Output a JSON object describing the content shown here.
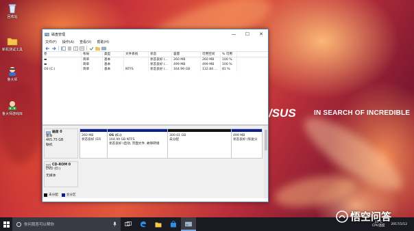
{
  "desktop": {
    "icons": [
      {
        "label": "回收站",
        "icon": "recycle-bin-icon"
      },
      {
        "label": "新机测试工具",
        "icon": "folder-icon"
      },
      {
        "label": "鲁大师",
        "icon": "ludashi-icon"
      },
      {
        "label": "鲁大师游戏库",
        "icon": "ludashi-game-icon"
      }
    ],
    "wallpaper": {
      "brand": "/SUS",
      "tagline": "IN SEARCH OF INCREDIBLE"
    }
  },
  "window": {
    "title": "磁盘管理",
    "controls": {
      "minimize": "—",
      "maximize": "☐",
      "close": "✕"
    },
    "menu": [
      "文件(F)",
      "操作(A)",
      "查看(V)",
      "帮助(H)"
    ],
    "volume_table": {
      "headers": [
        "卷",
        "布局",
        "类型",
        "文件系统",
        "状态",
        "容量",
        "可用空间",
        "% 可用"
      ],
      "rows": [
        [
          "▬",
          "简单",
          "基本",
          "",
          "状态良好 (...",
          "260 MB",
          "260 MB",
          "100 %"
        ],
        [
          "▬",
          "简单",
          "基本",
          "",
          "状态良好 (...",
          "499 MB",
          "499 MB",
          "100 %"
        ],
        [
          "OS (C:)",
          "简单",
          "基本",
          "NTFS",
          "状态良好 (...",
          "164.99 GB",
          "132.84 ...",
          "81 %"
        ]
      ]
    },
    "disks": [
      {
        "name": "磁盘 0",
        "type": "基本",
        "size": "465.75 GB",
        "status": "联机",
        "partitions": [
          {
            "name": "",
            "size": "260 MB",
            "status": "状态良好 (EFI",
            "strip": "blue"
          },
          {
            "name": "OS  (C:)",
            "size": "164.99 GB NTFS",
            "status": "状态良好 (启动, 页面文件, 故障转储",
            "strip": "blue"
          },
          {
            "name": "",
            "size": "300.01 GB",
            "status": "未分配",
            "strip": "black"
          },
          {
            "name": "",
            "size": "499 MB",
            "status": "状态良好 (恢复分",
            "strip": "blue"
          }
        ]
      },
      {
        "name": "CD-ROM 0",
        "type": "DVD (D:)",
        "size": "",
        "status": "无媒体",
        "partitions": []
      }
    ],
    "legend": [
      {
        "label": "未分配",
        "color": "#111111"
      },
      {
        "label": "主分区",
        "color": "#0c1f8a"
      }
    ]
  },
  "taskbar": {
    "search_placeholder": "你问我答可以帮你",
    "apps": [
      "task-view-icon",
      "edge-icon",
      "file-explorer-icon",
      "store-icon",
      "disk-management-icon"
    ],
    "tray": {
      "temp": "31°C",
      "temp_label": "CPU温度",
      "time": "",
      "date": "2017/1/12"
    }
  },
  "watermark": {
    "text": "悟空问答"
  }
}
